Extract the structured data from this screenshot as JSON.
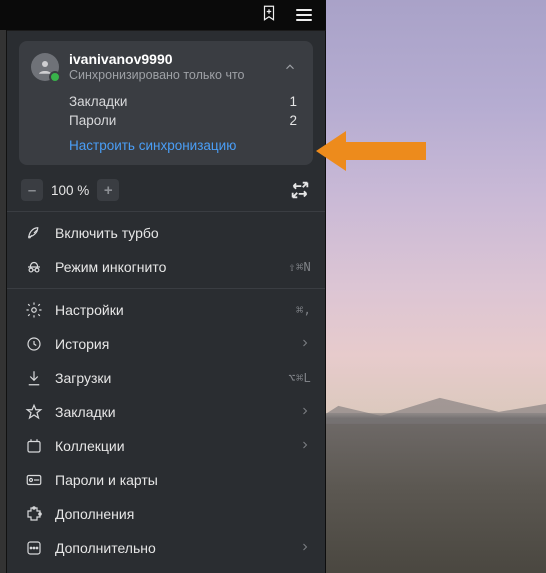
{
  "topbar": {
    "bookmark_icon": "bookmark-add",
    "menu_icon": "hamburger"
  },
  "sync": {
    "username": "ivanivanov9990",
    "status": "Синхронизировано только что",
    "rows": [
      {
        "label": "Закладки",
        "count": "1"
      },
      {
        "label": "Пароли",
        "count": "2"
      }
    ],
    "configure_link": "Настроить синхронизацию"
  },
  "zoom": {
    "minus": "–",
    "value": "100 %",
    "plus": "+"
  },
  "menu": {
    "turbo": {
      "label": "Включить турбо"
    },
    "incognito": {
      "label": "Режим инкогнито",
      "shortcut": "⇧⌘N"
    },
    "settings": {
      "label": "Настройки",
      "shortcut": "⌘,"
    },
    "history": {
      "label": "История"
    },
    "downloads": {
      "label": "Загрузки",
      "shortcut": "⌥⌘L"
    },
    "bookmarks": {
      "label": "Закладки"
    },
    "collections": {
      "label": "Коллекции"
    },
    "passwords": {
      "label": "Пароли и карты"
    },
    "addons": {
      "label": "Дополнения"
    },
    "more": {
      "label": "Дополнительно"
    }
  },
  "annotation": {
    "target": "sync.rows.1.count"
  }
}
